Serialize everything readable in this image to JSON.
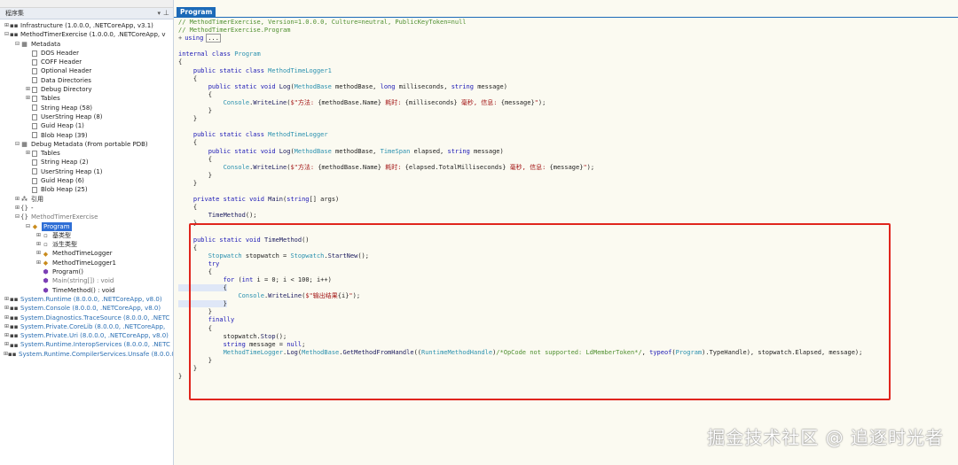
{
  "left_panel": {
    "title": "程序集",
    "tree": [
      {
        "indent": 0,
        "exp": "⊞",
        "icon": "assembly-icon",
        "glyph": "▪▪",
        "label": "Infrastructure (1.0.0.0, .NETCoreApp, v3.1)",
        "cls": ""
      },
      {
        "indent": 0,
        "exp": "⊟",
        "icon": "assembly-icon",
        "glyph": "▪▪",
        "label": "MethodTimerExercise (1.0.0.0, .NETCoreApp, v",
        "cls": ""
      },
      {
        "indent": 1,
        "exp": "⊟",
        "icon": "metadata-icon",
        "glyph": "▦",
        "label": "Metadata",
        "cls": ""
      },
      {
        "indent": 2,
        "exp": "",
        "icon": "file-icon",
        "glyph": "",
        "label": "DOS Header",
        "cls": "file"
      },
      {
        "indent": 2,
        "exp": "",
        "icon": "file-icon",
        "glyph": "",
        "label": "COFF Header",
        "cls": "file"
      },
      {
        "indent": 2,
        "exp": "",
        "icon": "file-icon",
        "glyph": "",
        "label": "Optional Header",
        "cls": "file"
      },
      {
        "indent": 2,
        "exp": "",
        "icon": "file-icon",
        "glyph": "",
        "label": "Data Directories",
        "cls": "file"
      },
      {
        "indent": 2,
        "exp": "⊞",
        "icon": "file-icon",
        "glyph": "",
        "label": "Debug Directory",
        "cls": "file"
      },
      {
        "indent": 2,
        "exp": "⊞",
        "icon": "file-icon",
        "glyph": "",
        "label": "Tables",
        "cls": "file"
      },
      {
        "indent": 2,
        "exp": "",
        "icon": "file-icon",
        "glyph": "",
        "label": "String Heap (58)",
        "cls": "file"
      },
      {
        "indent": 2,
        "exp": "",
        "icon": "file-icon",
        "glyph": "",
        "label": "UserString Heap (8)",
        "cls": "file"
      },
      {
        "indent": 2,
        "exp": "",
        "icon": "file-icon",
        "glyph": "",
        "label": "Guid Heap (1)",
        "cls": "file"
      },
      {
        "indent": 2,
        "exp": "",
        "icon": "file-icon",
        "glyph": "",
        "label": "Blob Heap (39)",
        "cls": "file"
      },
      {
        "indent": 1,
        "exp": "⊟",
        "icon": "metadata-icon",
        "glyph": "▦",
        "label": "Debug Metadata (From portable PDB)",
        "cls": ""
      },
      {
        "indent": 2,
        "exp": "⊞",
        "icon": "file-icon",
        "glyph": "",
        "label": "Tables",
        "cls": "file"
      },
      {
        "indent": 2,
        "exp": "",
        "icon": "file-icon",
        "glyph": "",
        "label": "String Heap (2)",
        "cls": "file"
      },
      {
        "indent": 2,
        "exp": "",
        "icon": "file-icon",
        "glyph": "",
        "label": "UserString Heap (1)",
        "cls": "file"
      },
      {
        "indent": 2,
        "exp": "",
        "icon": "file-icon",
        "glyph": "",
        "label": "Guid Heap (6)",
        "cls": "file"
      },
      {
        "indent": 2,
        "exp": "",
        "icon": "file-icon",
        "glyph": "",
        "label": "Blob Heap (25)",
        "cls": "file"
      },
      {
        "indent": 1,
        "exp": "⊞",
        "icon": "references-icon",
        "glyph": "⁂",
        "label": "引用",
        "cls": ""
      },
      {
        "indent": 1,
        "exp": "⊞",
        "icon": "namespace-icon",
        "glyph": "{}",
        "label": "-",
        "cls": ""
      },
      {
        "indent": 1,
        "exp": "⊟",
        "icon": "namespace-icon",
        "glyph": "{}",
        "label": "MethodTimerExercise",
        "cls": "dim"
      },
      {
        "indent": 2,
        "exp": "⊟",
        "icon": "class-icon",
        "glyph": "◆",
        "label": "Program",
        "cls": "sel"
      },
      {
        "indent": 3,
        "exp": "⊞",
        "icon": "base-type-icon",
        "glyph": "▫",
        "label": "基类型",
        "cls": ""
      },
      {
        "indent": 3,
        "exp": "⊞",
        "icon": "derived-type-icon",
        "glyph": "▫",
        "label": "派生类型",
        "cls": ""
      },
      {
        "indent": 3,
        "exp": "⊞",
        "icon": "class-icon",
        "glyph": "◆",
        "label": "MethodTimeLogger",
        "cls": ""
      },
      {
        "indent": 3,
        "exp": "⊞",
        "icon": "class-icon",
        "glyph": "◆",
        "label": "MethodTimeLogger1",
        "cls": ""
      },
      {
        "indent": 3,
        "exp": "",
        "icon": "method-icon",
        "glyph": "⬢",
        "label": "Program()",
        "cls": ""
      },
      {
        "indent": 3,
        "exp": "",
        "icon": "method-icon",
        "glyph": "⬢",
        "label": "Main(string[]) : void",
        "cls": "dim"
      },
      {
        "indent": 3,
        "exp": "",
        "icon": "method-icon",
        "glyph": "⬢",
        "label": "TimeMethod() : void",
        "cls": ""
      },
      {
        "indent": 0,
        "exp": "⊞",
        "icon": "assembly-icon",
        "glyph": "▪▪",
        "label": "System.Runtime (8.0.0.0, .NETCoreApp, v8.0)",
        "cls": "sys"
      },
      {
        "indent": 0,
        "exp": "⊞",
        "icon": "assembly-icon",
        "glyph": "▪▪",
        "label": "System.Console (8.0.0.0, .NETCoreApp, v8.0)",
        "cls": "sys"
      },
      {
        "indent": 0,
        "exp": "⊞",
        "icon": "assembly-icon",
        "glyph": "▪▪",
        "label": "System.Diagnostics.TraceSource (8.0.0.0, .NETC",
        "cls": "sys"
      },
      {
        "indent": 0,
        "exp": "⊞",
        "icon": "assembly-icon",
        "glyph": "▪▪",
        "label": "System.Private.CoreLib (8.0.0.0, .NETCoreApp,",
        "cls": "sys"
      },
      {
        "indent": 0,
        "exp": "⊞",
        "icon": "assembly-icon",
        "glyph": "▪▪",
        "label": "System.Private.Uri (8.0.0.0, .NETCoreApp, v8.0)",
        "cls": "sys"
      },
      {
        "indent": 0,
        "exp": "⊞",
        "icon": "assembly-icon",
        "glyph": "▪▪",
        "label": "System.Runtime.InteropServices (8.0.0.0, .NETC",
        "cls": "sys"
      },
      {
        "indent": 0,
        "exp": "⊞",
        "icon": "assembly-icon",
        "glyph": "▪▪",
        "label": "System.Runtime.CompilerServices.Unsafe (8.0.0.0",
        "cls": "sys"
      }
    ]
  },
  "editor": {
    "tab_label": "Program",
    "lines": [
      [
        [
          "cm",
          "// MethodTimerExercise, Version=1.0.0.0, Culture=neutral, PublicKeyToken=null"
        ]
      ],
      [
        [
          "cm",
          "// MethodTimerExercise.Program"
        ]
      ],
      [
        [
          "",
          "+"
        ],
        [
          "kw",
          "using"
        ],
        [
          "",
          ""
        ],
        [
          "",
          "..."
        ]
      ],
      [
        [
          "",
          ""
        ]
      ],
      [
        [
          "kw",
          "internal class "
        ],
        [
          "ty",
          "Program"
        ]
      ],
      [
        [
          "",
          "{"
        ]
      ],
      [
        [
          "",
          "    "
        ],
        [
          "kw",
          "public static class "
        ],
        [
          "ty",
          "MethodTimeLogger1"
        ]
      ],
      [
        [
          "",
          "    {"
        ]
      ],
      [
        [
          "",
          "        "
        ],
        [
          "kw",
          "public static void "
        ],
        [
          "fn",
          "Log"
        ],
        [
          "",
          "("
        ],
        [
          "ty",
          "MethodBase"
        ],
        [
          "",
          " methodBase, "
        ],
        [
          "kw",
          "long"
        ],
        [
          "",
          " milliseconds, "
        ],
        [
          "kw",
          "string"
        ],
        [
          "",
          " message)"
        ]
      ],
      [
        [
          "",
          "        {"
        ]
      ],
      [
        [
          "",
          "            "
        ],
        [
          "ty",
          "Console"
        ],
        [
          "",
          "."
        ],
        [
          "fn",
          "WriteLine"
        ],
        [
          "",
          "("
        ],
        [
          "st",
          "$\"方法: "
        ],
        [
          "",
          "{methodBase.Name}"
        ],
        [
          "st",
          " 耗时: "
        ],
        [
          "",
          "{milliseconds}"
        ],
        [
          "st",
          " 毫秒, 信息: "
        ],
        [
          "",
          "{message}"
        ],
        [
          "st",
          "\""
        ],
        [
          "",
          ");"
        ]
      ],
      [
        [
          "",
          "        }"
        ]
      ],
      [
        [
          "",
          "    }"
        ]
      ],
      [
        [
          "",
          ""
        ]
      ],
      [
        [
          "",
          "    "
        ],
        [
          "kw",
          "public static class "
        ],
        [
          "ty",
          "MethodTimeLogger"
        ]
      ],
      [
        [
          "",
          "    {"
        ]
      ],
      [
        [
          "",
          "        "
        ],
        [
          "kw",
          "public static void "
        ],
        [
          "fn",
          "Log"
        ],
        [
          "",
          "("
        ],
        [
          "ty",
          "MethodBase"
        ],
        [
          "",
          " methodBase, "
        ],
        [
          "ty",
          "TimeSpan"
        ],
        [
          "",
          " elapsed, "
        ],
        [
          "kw",
          "string"
        ],
        [
          "",
          " message)"
        ]
      ],
      [
        [
          "",
          "        {"
        ]
      ],
      [
        [
          "",
          "            "
        ],
        [
          "ty",
          "Console"
        ],
        [
          "",
          "."
        ],
        [
          "fn",
          "WriteLine"
        ],
        [
          "",
          "("
        ],
        [
          "st",
          "$\"方法: "
        ],
        [
          "",
          "{methodBase.Name}"
        ],
        [
          "st",
          " 耗时: "
        ],
        [
          "",
          "{elapsed.TotalMilliseconds}"
        ],
        [
          "st",
          " 毫秒, 信息: "
        ],
        [
          "",
          "{message}"
        ],
        [
          "st",
          "\""
        ],
        [
          "",
          ");"
        ]
      ],
      [
        [
          "",
          "        }"
        ]
      ],
      [
        [
          "",
          "    }"
        ]
      ],
      [
        [
          "",
          ""
        ]
      ],
      [
        [
          "",
          "    "
        ],
        [
          "kw",
          "private static void "
        ],
        [
          "fn",
          "Main"
        ],
        [
          "",
          "("
        ],
        [
          "kw",
          "string"
        ],
        [
          "",
          "[] args)"
        ]
      ],
      [
        [
          "",
          "    {"
        ]
      ],
      [
        [
          "",
          "        "
        ],
        [
          "fn",
          "TimeMethod"
        ],
        [
          "",
          "();"
        ]
      ],
      [
        [
          "",
          "    }"
        ]
      ],
      [
        [
          "",
          ""
        ]
      ],
      [
        [
          "",
          "    "
        ],
        [
          "kw",
          "public static void "
        ],
        [
          "fn",
          "TimeMethod"
        ],
        [
          "",
          "()"
        ]
      ],
      [
        [
          "",
          "    {"
        ]
      ],
      [
        [
          "",
          "        "
        ],
        [
          "ty",
          "Stopwatch"
        ],
        [
          "",
          " stopwatch = "
        ],
        [
          "ty",
          "Stopwatch"
        ],
        [
          "",
          "."
        ],
        [
          "fn",
          "StartNew"
        ],
        [
          "",
          "();"
        ]
      ],
      [
        [
          "",
          "        "
        ],
        [
          "kw",
          "try"
        ]
      ],
      [
        [
          "",
          "        {"
        ]
      ],
      [
        [
          "",
          "            "
        ],
        [
          "kw",
          "for"
        ],
        [
          "",
          " ("
        ],
        [
          "kw",
          "int"
        ],
        [
          "",
          " i = 0; i < 100; i++)"
        ]
      ],
      [
        [
          "",
          "            {"
        ]
      ],
      [
        [
          "",
          "                "
        ],
        [
          "ty",
          "Console"
        ],
        [
          "",
          "."
        ],
        [
          "fn",
          "WriteLine"
        ],
        [
          "",
          "("
        ],
        [
          "st",
          "$\"输出结果"
        ],
        [
          "",
          "{i}"
        ],
        [
          "st",
          "\""
        ],
        [
          "",
          ");"
        ]
      ],
      [
        [
          "",
          "            }"
        ]
      ],
      [
        [
          "",
          "        }"
        ]
      ],
      [
        [
          "",
          "        "
        ],
        [
          "kw",
          "finally"
        ]
      ],
      [
        [
          "",
          "        {"
        ]
      ],
      [
        [
          "",
          "            stopwatch."
        ],
        [
          "fn",
          "Stop"
        ],
        [
          "",
          "();"
        ]
      ],
      [
        [
          "",
          "            "
        ],
        [
          "kw",
          "string"
        ],
        [
          "",
          " message = "
        ],
        [
          "kw",
          "null"
        ],
        [
          "",
          ";"
        ]
      ],
      [
        [
          "",
          "            "
        ],
        [
          "ty",
          "MethodTimeLogger"
        ],
        [
          "",
          "."
        ],
        [
          "fn",
          "Log"
        ],
        [
          "",
          "("
        ],
        [
          "ty",
          "MethodBase"
        ],
        [
          "",
          "."
        ],
        [
          "fn",
          "GetMethodFromHandle"
        ],
        [
          "",
          "(("
        ],
        [
          "ty",
          "RuntimeMethodHandle"
        ],
        [
          "",
          ")"
        ],
        [
          "cm",
          "/*OpCode not supported: LdMemberToken*/"
        ],
        [
          "",
          ", "
        ],
        [
          "kw",
          "typeof"
        ],
        [
          "",
          "("
        ],
        [
          "ty",
          "Program"
        ],
        [
          "",
          ").TypeHandle), stopwatch.Elapsed, message);"
        ]
      ],
      [
        [
          "",
          "        }"
        ]
      ],
      [
        [
          "",
          "    }"
        ]
      ],
      [
        [
          "",
          "}"
        ]
      ]
    ]
  },
  "watermark": "掘金技术社区 @ 追逐时光者",
  "colors": {
    "accent": "#1c6ab8",
    "highlight_border": "#e0251d",
    "editor_bg": "#fbfaf1"
  }
}
